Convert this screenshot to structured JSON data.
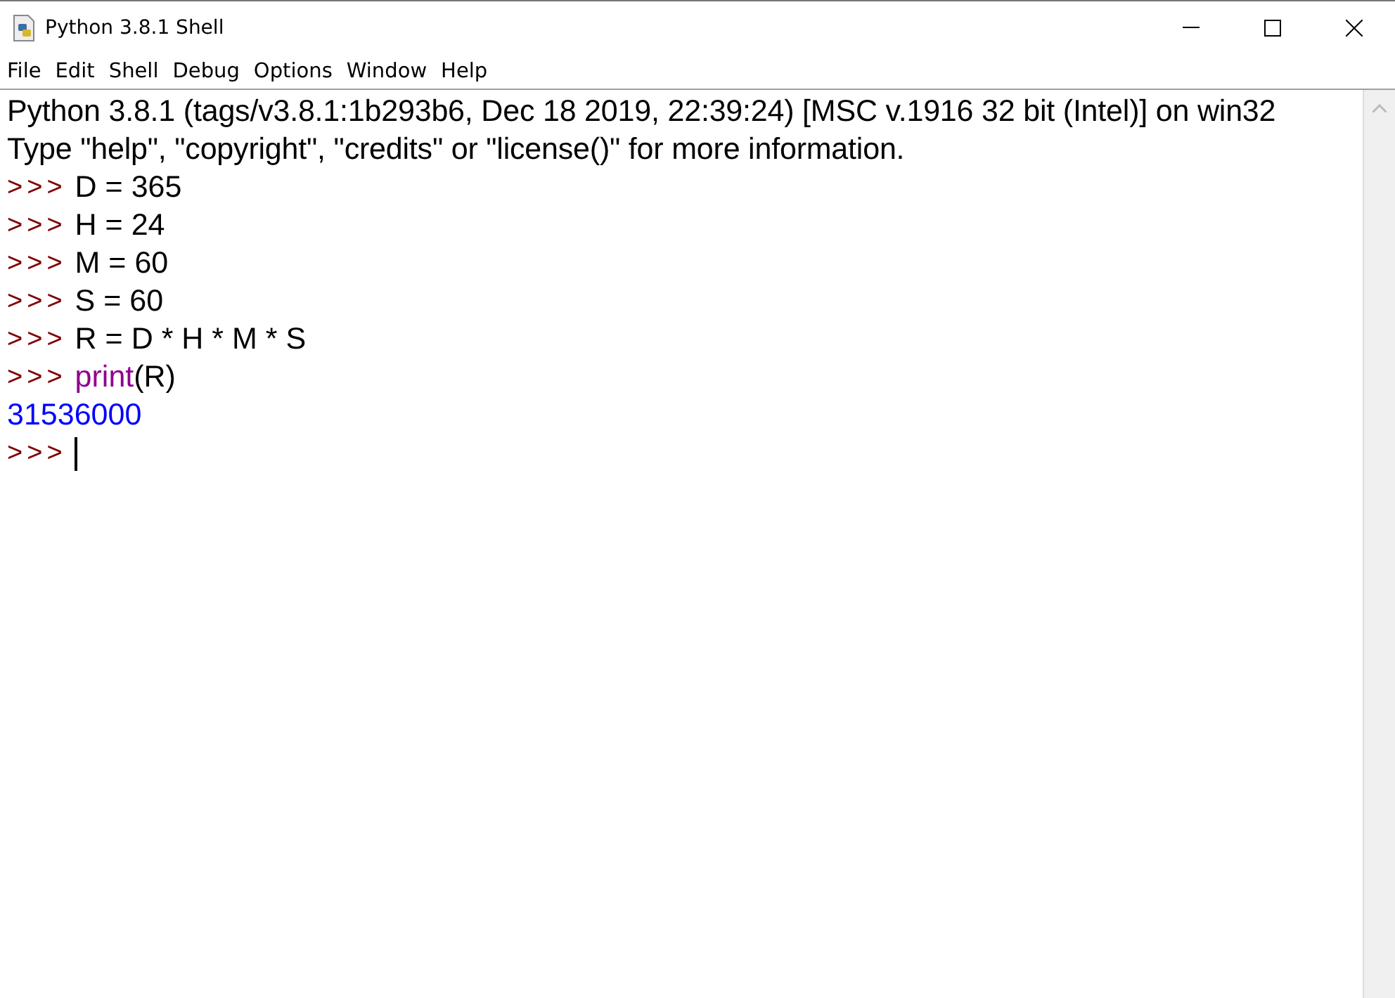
{
  "window": {
    "title": "Python 3.8.1 Shell"
  },
  "menu": [
    "File",
    "Edit",
    "Shell",
    "Debug",
    "Options",
    "Window",
    "Help"
  ],
  "shell_lines": [
    {
      "kind": "banner",
      "segments": [
        {
          "text": "Python 3.8.1 (tags/v3.8.1:1b293b6, Dec 18 2019, 22:39:24) [MSC v.1916 32 bit (Intel)] on win32",
          "kind": "plain"
        }
      ]
    },
    {
      "kind": "banner",
      "segments": [
        {
          "text": "Type \"help\", \"copyright\", \"credits\" or \"license()\" for more information.",
          "kind": "plain"
        }
      ]
    },
    {
      "kind": "input",
      "prompt": ">>>",
      "segments": [
        {
          "text": "D = 365",
          "kind": "plain"
        }
      ]
    },
    {
      "kind": "input",
      "prompt": ">>>",
      "segments": [
        {
          "text": "H = 24",
          "kind": "plain"
        }
      ]
    },
    {
      "kind": "input",
      "prompt": ">>>",
      "segments": [
        {
          "text": "M = 60",
          "kind": "plain"
        }
      ]
    },
    {
      "kind": "input",
      "prompt": ">>>",
      "segments": [
        {
          "text": "S = 60",
          "kind": "plain"
        }
      ]
    },
    {
      "kind": "input",
      "prompt": ">>>",
      "segments": [
        {
          "text": "R = D * H * M * S",
          "kind": "plain"
        }
      ]
    },
    {
      "kind": "input",
      "prompt": ">>>",
      "segments": [
        {
          "text": "print",
          "kind": "builtin"
        },
        {
          "text": "(R)",
          "kind": "plain"
        }
      ]
    },
    {
      "kind": "output",
      "segments": [
        {
          "text": "31536000",
          "kind": "plain"
        }
      ]
    },
    {
      "kind": "input",
      "prompt": ">>>",
      "cursor": true
    }
  ]
}
